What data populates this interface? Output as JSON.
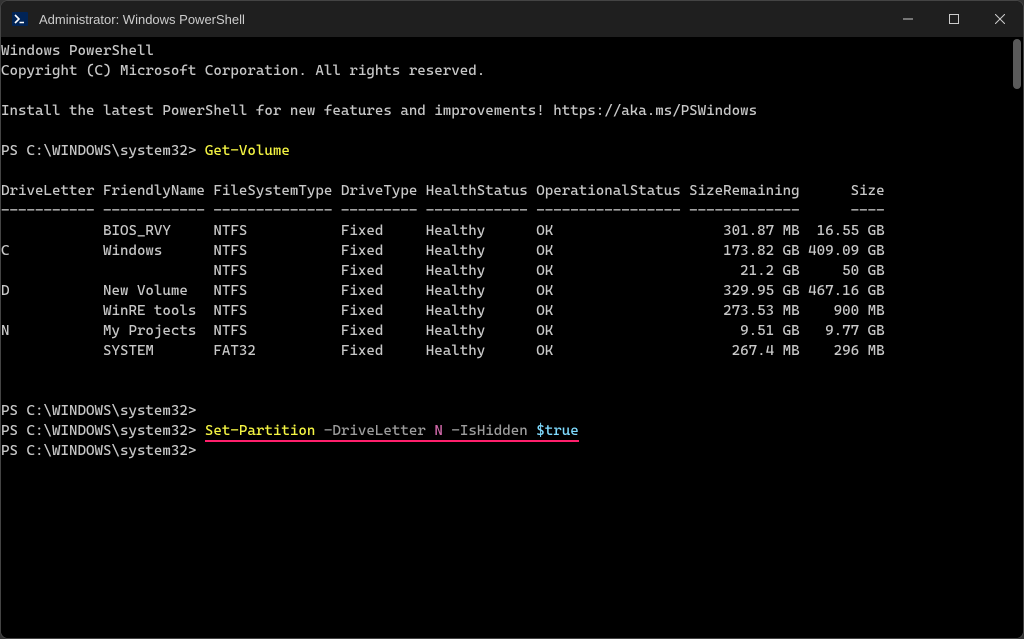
{
  "window": {
    "title": "Administrator: Windows PowerShell"
  },
  "terminal": {
    "header1": "Windows PowerShell",
    "header2": "Copyright (C) Microsoft Corporation. All rights reserved.",
    "header3": "Install the latest PowerShell for new features and improvements! https://aka.ms/PSWindows",
    "prompt": "PS C:\\WINDOWS\\system32>",
    "cmd1": "Get-Volume",
    "table": {
      "headers_line": "DriveLetter FriendlyName FileSystemType DriveType HealthStatus OperationalStatus SizeRemaining      Size",
      "dashes_line": "----------- ------------ -------------- --------- ------------ ----------------- -------------      ----",
      "rows": [
        "            BIOS_RVY     NTFS           Fixed     Healthy      OK                    301.87 MB  16.55 GB",
        "C           Windows      NTFS           Fixed     Healthy      OK                    173.82 GB 409.09 GB",
        "                         NTFS           Fixed     Healthy      OK                      21.2 GB     50 GB",
        "D           New Volume   NTFS           Fixed     Healthy      OK                    329.95 GB 467.16 GB",
        "            WinRE tools  NTFS           Fixed     Healthy      OK                    273.53 MB    900 MB",
        "N           My Projects  NTFS           Fixed     Healthy      OK                      9.51 GB   9.77 GB",
        "            SYSTEM       FAT32          Fixed     Healthy      OK                     267.4 MB    296 MB"
      ]
    },
    "cmd2": {
      "cmdlet": "Set-Partition",
      "param1": " -DriveLetter",
      "arg1": " N",
      "param2": " -IsHidden",
      "arg2": " $true"
    }
  }
}
